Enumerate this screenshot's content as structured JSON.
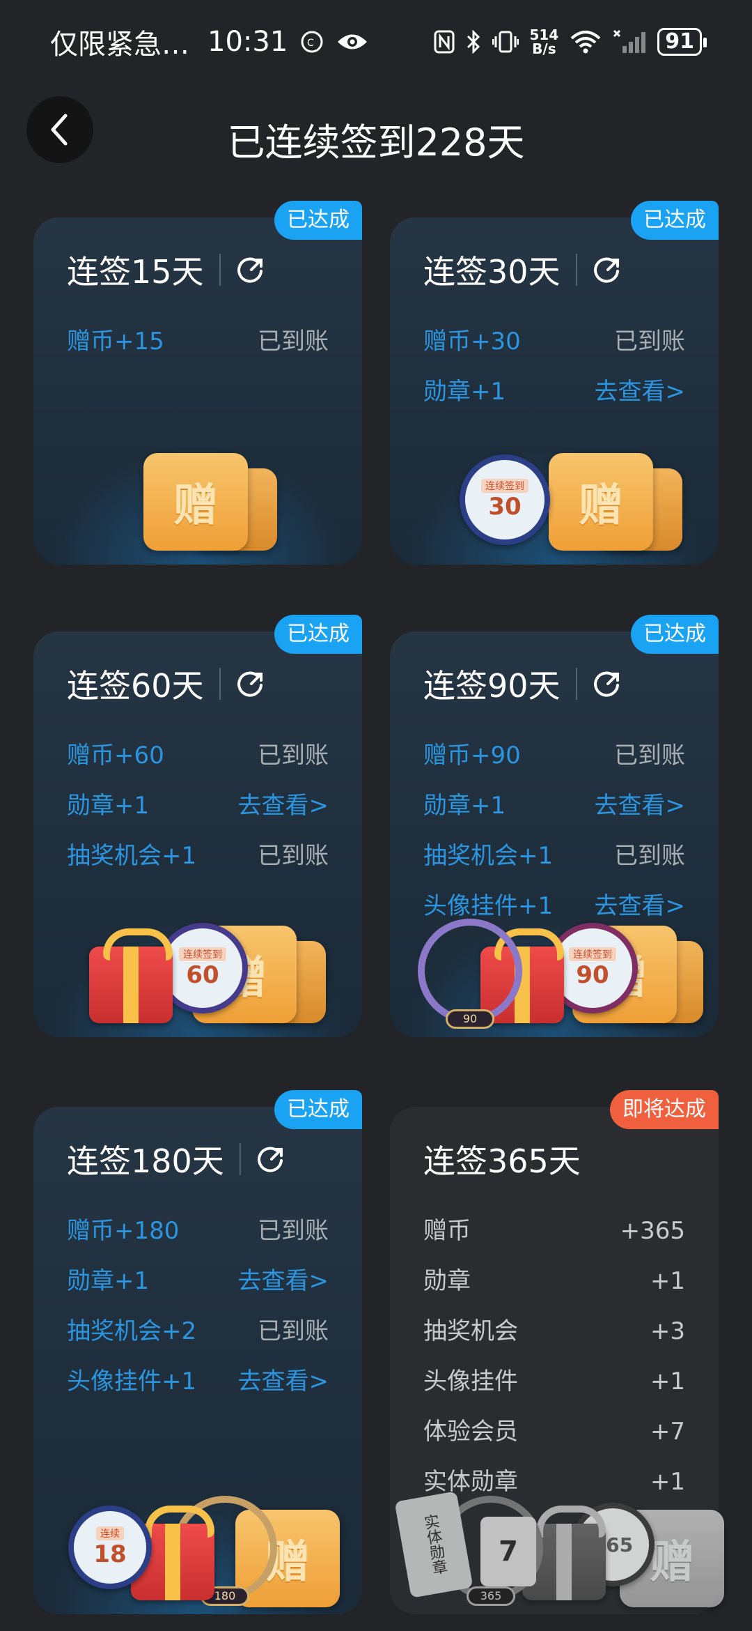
{
  "status_bar": {
    "left_text": "仅限紧急…",
    "time": "10:31",
    "net_speed_value": "514",
    "net_speed_unit": "B/s",
    "battery": "91"
  },
  "header": {
    "title": "已连续签到228天"
  },
  "cards": [
    {
      "title": "连签15天",
      "badge": "已达成",
      "rows": [
        {
          "label": "赠币+15",
          "value": "已到账"
        }
      ]
    },
    {
      "title": "连签30天",
      "badge": "已达成",
      "medal_line1": "连续签到",
      "medal_number": "30",
      "rows": [
        {
          "label": "赠币+30",
          "value": "已到账"
        },
        {
          "label": "勋章+1",
          "value": "去查看>"
        }
      ]
    },
    {
      "title": "连签60天",
      "badge": "已达成",
      "medal_line1": "连续签到",
      "medal_number": "60",
      "rows": [
        {
          "label": "赠币+60",
          "value": "已到账"
        },
        {
          "label": "勋章+1",
          "value": "去查看>"
        },
        {
          "label": "抽奖机会+1",
          "value": "已到账"
        }
      ]
    },
    {
      "title": "连签90天",
      "badge": "已达成",
      "medal_line1": "连续签到",
      "medal_number": "90",
      "plate_text": "90",
      "rows": [
        {
          "label": "赠币+90",
          "value": "已到账"
        },
        {
          "label": "勋章+1",
          "value": "去查看>"
        },
        {
          "label": "抽奖机会+1",
          "value": "已到账"
        },
        {
          "label": "头像挂件+1",
          "value": "去查看>"
        }
      ]
    },
    {
      "title": "连签180天",
      "badge": "已达成",
      "medal_line1": "连续",
      "medal_number": "18",
      "plate_text": "180",
      "rows": [
        {
          "label": "赠币+180",
          "value": "已到账"
        },
        {
          "label": "勋章+1",
          "value": "去查看>"
        },
        {
          "label": "抽奖机会+2",
          "value": "已到账"
        },
        {
          "label": "头像挂件+1",
          "value": "去查看>"
        }
      ]
    },
    {
      "title": "连签365天",
      "badge": "即将达成",
      "medal_number": "365",
      "plate_text": "365",
      "physical_badge_text": "实体勋章",
      "vip_number": "7",
      "rows": [
        {
          "label": "赠币",
          "value": "+365"
        },
        {
          "label": "勋章",
          "value": "+1"
        },
        {
          "label": "抽奖机会",
          "value": "+3"
        },
        {
          "label": "头像挂件",
          "value": "+1"
        },
        {
          "label": "体验会员",
          "value": "+7"
        },
        {
          "label": "实体勋章",
          "value": "+1"
        }
      ]
    }
  ],
  "ticket_char": "赠",
  "colors": {
    "accent_blue": "#1aa3f2",
    "accent_orange": "#f0603e",
    "link_blue": "#2b95e0",
    "background": "#232427"
  }
}
